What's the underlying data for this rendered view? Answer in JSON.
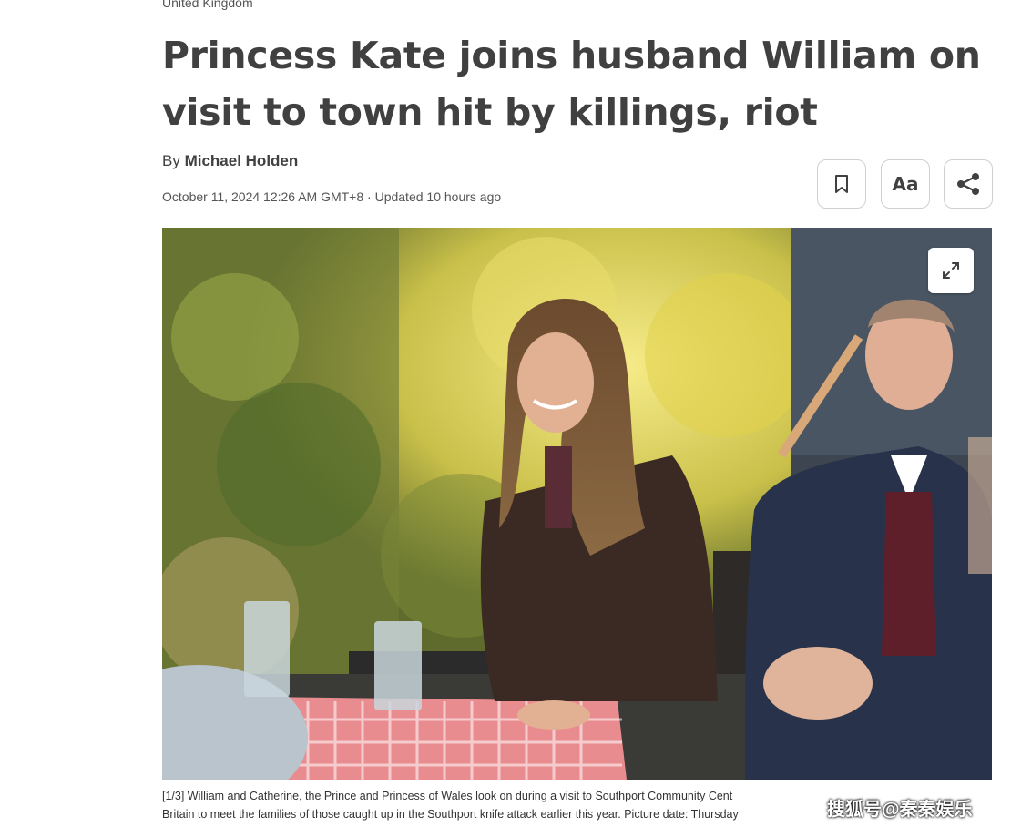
{
  "article": {
    "section": "United Kingdom",
    "headline": "Princess Kate joins husband William on visit to town hit by killings, riot",
    "byline_prefix": "By",
    "author": "Michael Holden",
    "timestamp": "October 11, 2024 12:26 AM GMT+8 · Updated 10 hours ago"
  },
  "toolbar": {
    "bookmark_icon": "bookmark-icon",
    "text_size_label": "Aa",
    "share_icon": "share-icon"
  },
  "photo": {
    "expand_icon": "expand-icon",
    "caption_line1": "[1/3] William and Catherine, the Prince and Princess of Wales look on during a visit to Southport Community Cent",
    "caption_line2": "Britain to meet the families of those caught up in the Southport knife attack earlier this year. Picture date: Thursday"
  },
  "watermark": "搜狐号@秦秦娱乐"
}
